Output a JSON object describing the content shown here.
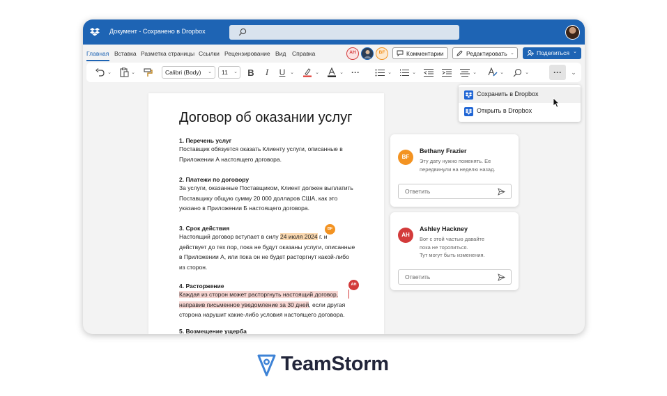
{
  "app": {
    "window_title": "Документ - Сохранено в Dropbox",
    "colors": {
      "accent": "#1e64b4",
      "dropbox": "#1e64d4",
      "bf": "#f39322",
      "ah": "#d33a3a"
    }
  },
  "menu": {
    "tabs": [
      "Главная",
      "Вставка",
      "Разметка страницы",
      "Ссылки",
      "Рецензирование",
      "Вид",
      "Справка"
    ],
    "presence": [
      "AH",
      "BF"
    ],
    "comments_label": "Комментарии",
    "edit_label": "Редактировать",
    "share_label": "Поделиться"
  },
  "toolbar": {
    "font_name": "Calibri (Body)",
    "font_size": "11",
    "bold": "B",
    "italic": "I",
    "underline": "U",
    "more": "···"
  },
  "dropdown": {
    "items": [
      "Сохранить в Dropbox",
      "Открыть в Dropbox"
    ]
  },
  "document": {
    "title": "Договор об оказании услуг",
    "s1_heading": "1. Перечень услуг",
    "s1_l1": "Поставщик обязуется оказать Клиенту услуги, описанные в",
    "s1_l2": "Приложении А настоящего договора.",
    "s2_heading": "2. Платежи по договору",
    "s2_l1": "За услуги, оказанные Поставщиком, Клиент должен выплатить",
    "s2_l2": "Поставщику общую сумму 20 000 долларов США, как это",
    "s2_l3": "указано в Приложении Б настоящего договора.",
    "s3_heading": "3. Срок действия",
    "s3_l1_a": "Настоящий договор вступает в силу ",
    "s3_l1_hl": "24 июля 2024",
    "s3_l1_b": " г. и",
    "s3_l2": "действует до тех пор, пока не будут оказаны услуги, описанные",
    "s3_l3": "в Приложении А, или пока он не будет расторгнут какой-либо",
    "s3_l4": "из сторон.",
    "s4_heading": "4. Расторжение",
    "s4_l1_hl": "Каждая из сторон может расторгнуть настоящий договор,",
    "s4_l2_hl": "направив письменное уведомление за 30 дней",
    "s4_l2_b": ", если другая",
    "s4_l3": "сторона нарушит какие-либо условия настоящего договора.",
    "s5_heading": "5. Возмещение ущерба",
    "marker_bf": "BF",
    "marker_ah": "AH"
  },
  "comments": [
    {
      "initials": "BF",
      "name": "Bethany Frazier",
      "line1": "Эту дату нужно поменять. Ее",
      "line2": "передвинули на неделю назад.",
      "line3": "",
      "reply_placeholder": "Ответить"
    },
    {
      "initials": "AH",
      "name": "Ashley Hackney",
      "line1": "Вот с этой частью давайте",
      "line2": "пока не торопиться.",
      "line3": "Тут могут быть изменения.",
      "reply_placeholder": "Ответить"
    }
  ],
  "brand": {
    "name": "TeamStorm"
  }
}
